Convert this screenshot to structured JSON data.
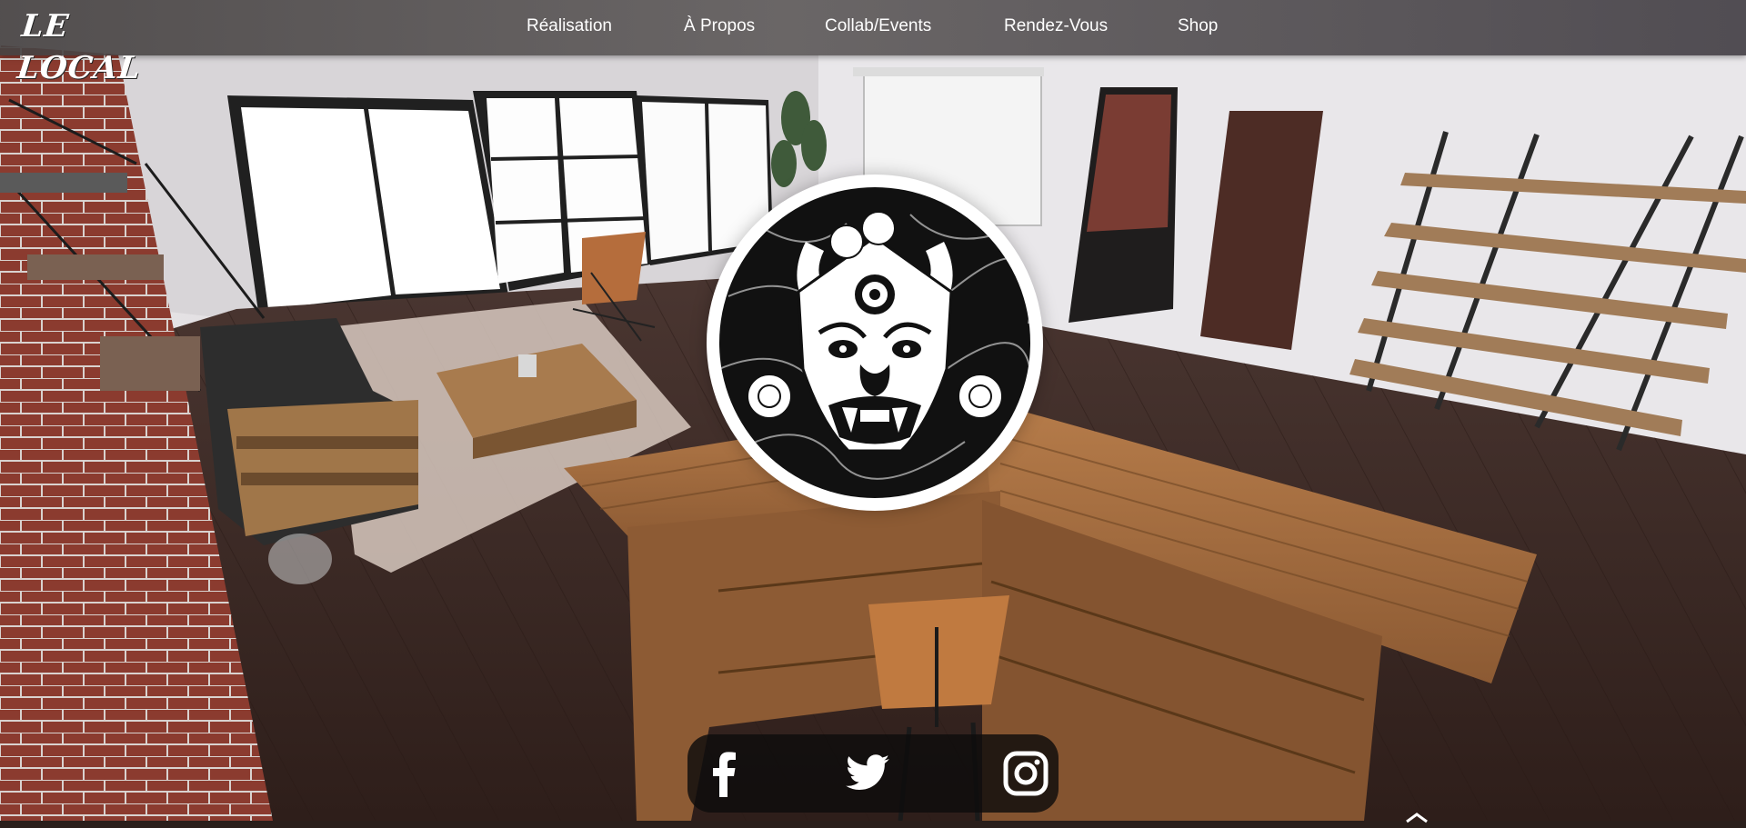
{
  "brand": {
    "logo_text": "LE LOCAL"
  },
  "nav": {
    "items": [
      {
        "label": "Réalisation"
      },
      {
        "label": "À Propos"
      },
      {
        "label": "Collab/Events"
      },
      {
        "label": "Rendez-Vous"
      },
      {
        "label": "Shop"
      }
    ]
  },
  "emblem": {
    "icon": "demon-mask-icon"
  },
  "social": {
    "icons": [
      "facebook-icon",
      "twitter-icon",
      "instagram-icon"
    ]
  },
  "colors": {
    "nav_bg": "#4e4a4a",
    "floor": "#3a2722",
    "wood": "#a86d3e",
    "brick": "#8a3a2e",
    "emblem_dark": "#111111",
    "social_bg": "#0e0c0c"
  }
}
